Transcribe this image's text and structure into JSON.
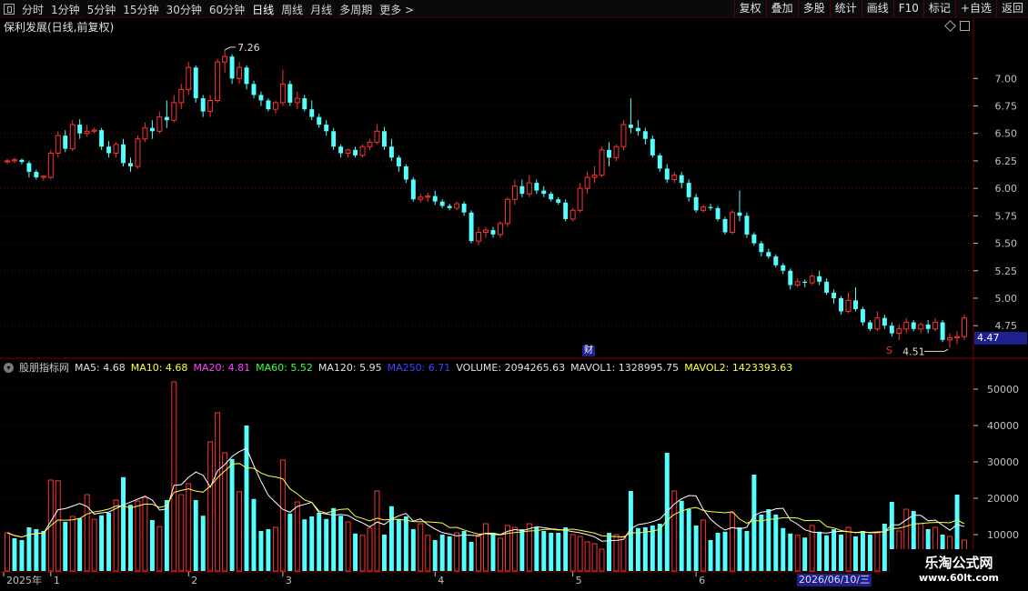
{
  "toolbar": {
    "periods": [
      "分时",
      "1分钟",
      "5分钟",
      "15分钟",
      "30分钟",
      "60分钟",
      "日线",
      "周线",
      "月线",
      "多周期",
      "更多 >"
    ],
    "active_period": "日线",
    "right_buttons": [
      "复权",
      "叠加",
      "多股",
      "统计",
      "画线",
      "F10",
      "标记",
      "+自选",
      "返回"
    ]
  },
  "stock_title": "保利发展(日线,前复权)",
  "indicator_legend": [
    {
      "label": "股朋指标网",
      "color": "#c8c8c8"
    },
    {
      "label": "MA5: 4.68",
      "color": "#e0e0e0"
    },
    {
      "label": "MA10: 4.68",
      "color": "#ffff40"
    },
    {
      "label": "MA20: 4.81",
      "color": "#ff40ff"
    },
    {
      "label": "MA60: 5.52",
      "color": "#40ff40"
    },
    {
      "label": "MA120: 5.95",
      "color": "#e0e0e0"
    },
    {
      "label": "MA250: 6.71",
      "color": "#4040ff"
    },
    {
      "label": "VOLUME: 2094265.63",
      "color": "#e0e0e0"
    },
    {
      "label": "MAVOL1: 1328995.75",
      "color": "#e0e0e0"
    },
    {
      "label": "MAVOL2: 1423393.63",
      "color": "#ffff40"
    }
  ],
  "price_tag": "4.47",
  "date_tag": "2026/06/10/三",
  "annotations": {
    "high": "7.26",
    "low": "4.51",
    "cai": "财",
    "s_mark": "S"
  },
  "watermark": {
    "line1": "乐淘公式网",
    "line2": "www.60lt.com"
  },
  "colors": {
    "up": "#ff3232",
    "down": "#54ffff",
    "grid": "#7a0000",
    "axis": "#c0c0c0",
    "mavol1": "#ffffff",
    "mavol2": "#ffff40"
  },
  "chart_data": {
    "type": "candlestick",
    "price_axis": {
      "ticks": [
        7.0,
        6.75,
        6.5,
        6.25,
        6.0,
        5.75,
        5.5,
        5.25,
        5.0,
        4.75
      ],
      "ylim": [
        4.47,
        7.4
      ]
    },
    "volume_axis": {
      "ticks": [
        10000,
        20000,
        30000,
        40000,
        50000
      ],
      "ylim": [
        0,
        55000
      ]
    },
    "x_labels": [
      {
        "label": "2025年",
        "index": 0
      },
      {
        "label": "1",
        "index": 6
      },
      {
        "label": "2",
        "index": 25
      },
      {
        "label": "3",
        "index": 38
      },
      {
        "label": "4",
        "index": 59
      },
      {
        "label": "5",
        "index": 78
      },
      {
        "label": "6",
        "index": 95
      }
    ],
    "candles": [
      [
        6.25,
        6.27,
        6.22,
        6.25
      ],
      [
        6.25,
        6.28,
        6.23,
        6.26
      ],
      [
        6.26,
        6.27,
        6.22,
        6.24
      ],
      [
        6.23,
        6.25,
        6.1,
        6.15
      ],
      [
        6.15,
        6.17,
        6.08,
        6.1
      ],
      [
        6.1,
        6.12,
        6.07,
        6.11
      ],
      [
        6.1,
        6.35,
        6.08,
        6.32
      ],
      [
        6.32,
        6.52,
        6.28,
        6.48
      ],
      [
        6.48,
        6.53,
        6.33,
        6.36
      ],
      [
        6.36,
        6.62,
        6.34,
        6.58
      ],
      [
        6.58,
        6.63,
        6.45,
        6.5
      ],
      [
        6.5,
        6.58,
        6.47,
        6.52
      ],
      [
        6.52,
        6.55,
        6.5,
        6.53
      ],
      [
        6.53,
        6.55,
        6.35,
        6.38
      ],
      [
        6.38,
        6.43,
        6.28,
        6.32
      ],
      [
        6.32,
        6.42,
        6.28,
        6.4
      ],
      [
        6.4,
        6.45,
        6.2,
        6.23
      ],
      [
        6.23,
        6.28,
        6.15,
        6.2
      ],
      [
        6.2,
        6.48,
        6.18,
        6.45
      ],
      [
        6.45,
        6.6,
        6.42,
        6.55
      ],
      [
        6.55,
        6.62,
        6.45,
        6.52
      ],
      [
        6.52,
        6.7,
        6.5,
        6.65
      ],
      [
        6.65,
        6.8,
        6.55,
        6.62
      ],
      [
        6.62,
        6.85,
        6.6,
        6.78
      ],
      [
        6.78,
        6.95,
        6.72,
        6.9
      ],
      [
        6.9,
        7.15,
        6.85,
        7.1
      ],
      [
        7.1,
        7.12,
        6.78,
        6.82
      ],
      [
        6.82,
        6.85,
        6.65,
        6.7
      ],
      [
        6.7,
        6.85,
        6.65,
        6.8
      ],
      [
        6.8,
        7.18,
        6.78,
        7.15
      ],
      [
        7.15,
        7.26,
        7.05,
        7.2
      ],
      [
        7.2,
        7.22,
        6.95,
        7.0
      ],
      [
        7.0,
        7.15,
        6.95,
        7.1
      ],
      [
        7.1,
        7.12,
        6.9,
        6.95
      ],
      [
        6.95,
        6.98,
        6.82,
        6.85
      ],
      [
        6.85,
        6.88,
        6.75,
        6.8
      ],
      [
        6.8,
        6.82,
        6.7,
        6.72
      ],
      [
        6.72,
        6.8,
        6.68,
        6.78
      ],
      [
        6.78,
        7.08,
        6.75,
        6.95
      ],
      [
        6.95,
        6.98,
        6.75,
        6.78
      ],
      [
        6.78,
        6.88,
        6.72,
        6.82
      ],
      [
        6.82,
        6.85,
        6.7,
        6.72
      ],
      [
        6.72,
        6.8,
        6.62,
        6.65
      ],
      [
        6.65,
        6.68,
        6.55,
        6.58
      ],
      [
        6.58,
        6.62,
        6.48,
        6.52
      ],
      [
        6.52,
        6.55,
        6.35,
        6.38
      ],
      [
        6.38,
        6.4,
        6.28,
        6.32
      ],
      [
        6.32,
        6.36,
        6.28,
        6.35
      ],
      [
        6.35,
        6.38,
        6.28,
        6.3
      ],
      [
        6.3,
        6.4,
        6.28,
        6.38
      ],
      [
        6.38,
        6.45,
        6.35,
        6.42
      ],
      [
        6.42,
        6.58,
        6.4,
        6.52
      ],
      [
        6.52,
        6.56,
        6.35,
        6.38
      ],
      [
        6.38,
        6.45,
        6.25,
        6.28
      ],
      [
        6.28,
        6.3,
        6.15,
        6.2
      ],
      [
        6.2,
        6.22,
        6.05,
        6.08
      ],
      [
        6.08,
        6.1,
        5.88,
        5.9
      ],
      [
        5.9,
        5.95,
        5.87,
        5.92
      ],
      [
        5.92,
        5.96,
        5.88,
        5.93
      ],
      [
        5.93,
        5.98,
        5.85,
        5.88
      ],
      [
        5.88,
        5.9,
        5.82,
        5.84
      ],
      [
        5.84,
        5.86,
        5.8,
        5.82
      ],
      [
        5.82,
        5.88,
        5.8,
        5.86
      ],
      [
        5.86,
        5.88,
        5.75,
        5.78
      ],
      [
        5.78,
        5.8,
        5.5,
        5.52
      ],
      [
        5.52,
        5.65,
        5.48,
        5.6
      ],
      [
        5.6,
        5.65,
        5.55,
        5.62
      ],
      [
        5.62,
        5.65,
        5.55,
        5.58
      ],
      [
        5.58,
        5.7,
        5.55,
        5.68
      ],
      [
        5.68,
        5.92,
        5.65,
        5.9
      ],
      [
        5.9,
        6.08,
        5.85,
        6.02
      ],
      [
        6.02,
        6.08,
        5.92,
        5.95
      ],
      [
        5.95,
        6.12,
        5.92,
        6.05
      ],
      [
        6.05,
        6.08,
        5.95,
        5.98
      ],
      [
        5.98,
        6.02,
        5.92,
        5.95
      ],
      [
        5.95,
        5.97,
        5.88,
        5.9
      ],
      [
        5.9,
        5.92,
        5.85,
        5.87
      ],
      [
        5.87,
        5.9,
        5.7,
        5.72
      ],
      [
        5.72,
        5.82,
        5.7,
        5.8
      ],
      [
        5.8,
        6.05,
        5.78,
        6.0
      ],
      [
        6.0,
        6.15,
        5.95,
        6.1
      ],
      [
        6.1,
        6.2,
        6.05,
        6.12
      ],
      [
        6.12,
        6.38,
        6.1,
        6.35
      ],
      [
        6.35,
        6.42,
        6.2,
        6.28
      ],
      [
        6.28,
        6.4,
        6.25,
        6.38
      ],
      [
        6.38,
        6.62,
        6.35,
        6.58
      ],
      [
        6.58,
        6.82,
        6.5,
        6.55
      ],
      [
        6.55,
        6.62,
        6.48,
        6.52
      ],
      [
        6.52,
        6.55,
        6.4,
        6.45
      ],
      [
        6.45,
        6.48,
        6.28,
        6.3
      ],
      [
        6.3,
        6.32,
        6.15,
        6.18
      ],
      [
        6.18,
        6.22,
        6.05,
        6.08
      ],
      [
        6.08,
        6.15,
        6.05,
        6.12
      ],
      [
        6.12,
        6.15,
        6.0,
        6.05
      ],
      [
        6.05,
        6.08,
        5.88,
        5.92
      ],
      [
        5.92,
        5.95,
        5.78,
        5.8
      ],
      [
        5.8,
        5.85,
        5.78,
        5.83
      ],
      [
        5.83,
        5.86,
        5.8,
        5.82
      ],
      [
        5.82,
        5.84,
        5.7,
        5.72
      ],
      [
        5.72,
        5.74,
        5.58,
        5.6
      ],
      [
        5.6,
        5.8,
        5.58,
        5.78
      ],
      [
        5.78,
        5.98,
        5.7,
        5.75
      ],
      [
        5.75,
        5.78,
        5.55,
        5.58
      ],
      [
        5.58,
        5.6,
        5.48,
        5.5
      ],
      [
        5.5,
        5.52,
        5.38,
        5.42
      ],
      [
        5.42,
        5.45,
        5.36,
        5.38
      ],
      [
        5.38,
        5.4,
        5.28,
        5.3
      ],
      [
        5.3,
        5.32,
        5.22,
        5.25
      ],
      [
        5.25,
        5.27,
        5.08,
        5.12
      ],
      [
        5.12,
        5.18,
        5.1,
        5.15
      ],
      [
        5.15,
        5.17,
        5.1,
        5.14
      ],
      [
        5.14,
        5.22,
        5.12,
        5.2
      ],
      [
        5.2,
        5.25,
        5.12,
        5.15
      ],
      [
        5.15,
        5.18,
        5.03,
        5.05
      ],
      [
        5.05,
        5.08,
        4.95,
        5.0
      ],
      [
        5.0,
        5.02,
        4.85,
        4.88
      ],
      [
        4.88,
        5.05,
        4.86,
        4.98
      ],
      [
        4.98,
        5.1,
        4.88,
        4.9
      ],
      [
        4.9,
        4.92,
        4.75,
        4.78
      ],
      [
        4.78,
        4.8,
        4.7,
        4.72
      ],
      [
        4.72,
        4.88,
        4.7,
        4.82
      ],
      [
        4.82,
        4.85,
        4.72,
        4.75
      ],
      [
        4.75,
        4.78,
        4.65,
        4.68
      ],
      [
        4.68,
        4.76,
        4.62,
        4.72
      ],
      [
        4.72,
        4.82,
        4.68,
        4.78
      ],
      [
        4.78,
        4.8,
        4.7,
        4.72
      ],
      [
        4.72,
        4.78,
        4.68,
        4.76
      ],
      [
        4.76,
        4.8,
        4.68,
        4.72
      ],
      [
        4.72,
        4.82,
        4.7,
        4.78
      ],
      [
        4.78,
        4.8,
        4.6,
        4.62
      ],
      [
        4.62,
        4.68,
        4.55,
        4.64
      ],
      [
        4.64,
        4.7,
        4.58,
        4.65
      ],
      [
        4.65,
        4.85,
        4.62,
        4.82
      ]
    ],
    "volume_up": [
      1,
      0,
      0,
      0,
      0,
      0,
      1,
      1,
      0,
      1,
      0,
      1,
      1,
      0,
      0,
      1,
      0,
      0,
      1,
      1,
      0,
      1,
      0,
      1,
      1,
      1,
      0,
      0,
      1,
      1,
      1,
      0,
      1,
      0,
      0,
      0,
      0,
      1,
      1,
      0,
      1,
      0,
      0,
      0,
      0,
      0,
      0,
      1,
      0,
      1,
      1,
      1,
      0,
      0,
      0,
      0,
      0,
      1,
      1,
      0,
      0,
      0,
      1,
      0,
      0,
      1,
      1,
      0,
      1,
      1,
      1,
      0,
      1,
      0,
      0,
      0,
      0,
      0,
      1,
      1,
      1,
      1,
      1,
      0,
      1,
      1,
      0,
      0,
      0,
      0,
      0,
      0,
      1,
      0,
      0,
      0,
      1,
      0,
      0,
      0,
      1,
      0,
      0,
      0,
      0,
      0,
      0,
      0,
      0,
      1,
      0,
      1,
      0,
      0,
      0,
      0,
      1,
      0,
      0,
      0,
      1,
      0,
      0,
      1,
      1,
      0,
      1,
      0,
      1,
      0,
      1,
      0,
      1
    ],
    "volumes": [
      10500,
      9000,
      8500,
      12000,
      11500,
      11000,
      25000,
      24800,
      13500,
      15000,
      14500,
      21000,
      14200,
      15300,
      16000,
      19500,
      25800,
      18200,
      19200,
      20200,
      14000,
      12200,
      19500,
      52000,
      21000,
      24000,
      19500,
      15200,
      35500,
      43500,
      32500,
      30800,
      21800,
      40000,
      19800,
      11000,
      11500,
      12000,
      30500,
      15800,
      19000,
      14200,
      15000,
      16000,
      14300,
      17300,
      15200,
      13500,
      10300,
      9800,
      11800,
      22000,
      10000,
      17800,
      14300,
      15000,
      11500,
      13000,
      9800,
      8500,
      10000,
      9500,
      10500,
      11000,
      8000,
      9500,
      13000,
      10500,
      9000,
      12500,
      12000,
      11500,
      13000,
      12000,
      11000,
      10500,
      10500,
      12000,
      10000,
      9500,
      8000,
      7500,
      6000,
      10500,
      10000,
      9500,
      22000,
      11800,
      12000,
      12500,
      13000,
      32500,
      22000,
      19300,
      17000,
      12500,
      14000,
      8500,
      10500,
      10800,
      16000,
      12000,
      11000,
      26500,
      15500,
      17000,
      15500,
      11800,
      10300,
      9800,
      9200,
      12500,
      10800,
      9800,
      11500,
      10000,
      12000,
      9500,
      11000,
      10000,
      10500,
      13000,
      19000,
      11000,
      17000,
      16500,
      13000,
      11500,
      12000,
      10000,
      9500,
      21000,
      8500
    ]
  }
}
